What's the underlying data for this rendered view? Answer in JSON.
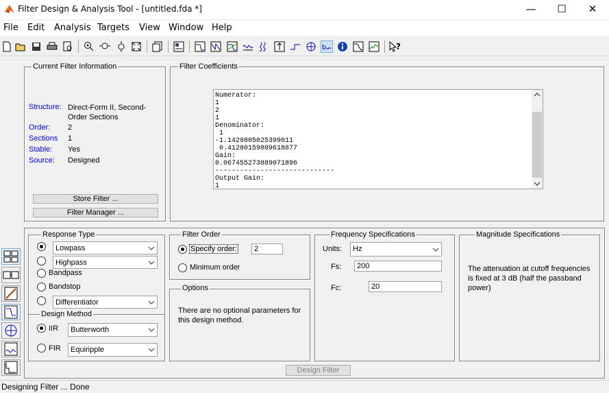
{
  "window": {
    "title": "Filter Design & Analysis Tool -  [untitled.fda *]",
    "min_glyph": "—",
    "max_glyph": "☐",
    "close_glyph": "✕"
  },
  "menu": [
    "File",
    "Edit",
    "Analysis",
    "Targets",
    "View",
    "Window",
    "Help"
  ],
  "toolbar_icons": [
    "new-icon",
    "open-icon",
    "save-icon",
    "print-icon",
    "print-preview-icon",
    "zoom-in-icon",
    "zoom-x-icon",
    "zoom-y-icon",
    "full-view-icon",
    "new-figure-icon",
    "design-panel-icon",
    "magnitude-response-icon",
    "phase-response-icon",
    "magnitude-phase-icon",
    "group-delay-icon",
    "phase-delay-icon",
    "impulse-response-icon",
    "step-response-icon",
    "pole-zero-icon",
    "coefficients-icon",
    "information-icon",
    "magnitude-estimate-icon",
    "round-off-noise-icon",
    "whats-this-icon"
  ],
  "current_filter": {
    "title": "Current Filter Information",
    "rows": [
      {
        "label": "Structure:",
        "value": "Direct-Form II, Second-Order Sections"
      },
      {
        "label": "Order:",
        "value": "2"
      },
      {
        "label": "Sections",
        "value": "1"
      },
      {
        "label": "Stable:",
        "value": "Yes"
      },
      {
        "label": "Source:",
        "value": "Designed"
      }
    ],
    "store_button": "Store Filter ...",
    "manager_button": "Filter Manager ..."
  },
  "coefficients": {
    "title": "Filter Coefficients",
    "text": "Numerator:\n1\n2\n1\nDenominator:\n 1\n-1.1429805025399011\n 0.41280159809618877\nGain:\n0.067455273889071896\n-----------------------------\nOutput Gain:\n1"
  },
  "response_type": {
    "title": "Response Type",
    "options": [
      {
        "label": "Lowpass",
        "selected": true,
        "dropdown": true
      },
      {
        "label": "Highpass",
        "selected": false,
        "dropdown": true
      },
      {
        "label": "Bandpass",
        "selected": false,
        "dropdown": false
      },
      {
        "label": "Bandstop",
        "selected": false,
        "dropdown": false
      },
      {
        "label": "Differentiator",
        "selected": false,
        "dropdown": true
      }
    ]
  },
  "design_method": {
    "title": "Design Method",
    "iir_label": "IIR",
    "iir_value": "Butterworth",
    "fir_label": "FIR",
    "fir_value": "Equiripple"
  },
  "filter_order": {
    "title": "Filter Order",
    "specify_label": "Specify order:",
    "specify_value": "2",
    "minimum_label": "Minimum order"
  },
  "options": {
    "title": "Options",
    "text": "There are no optional parameters for this design method."
  },
  "frequency": {
    "title": "Frequency Specifications",
    "units_label": "Units:",
    "units_value": "Hz",
    "fs_label": "Fs:",
    "fs_value": "200",
    "fc_label": "Fc:",
    "fc_value": "20"
  },
  "magnitude": {
    "title": "Magnitude Specifications",
    "text": "The attenuation at cutoff frequencies is fixed at 3 dB (half the passband power)"
  },
  "design_button": "Design Filter",
  "status": "Designing Filter ... Done"
}
